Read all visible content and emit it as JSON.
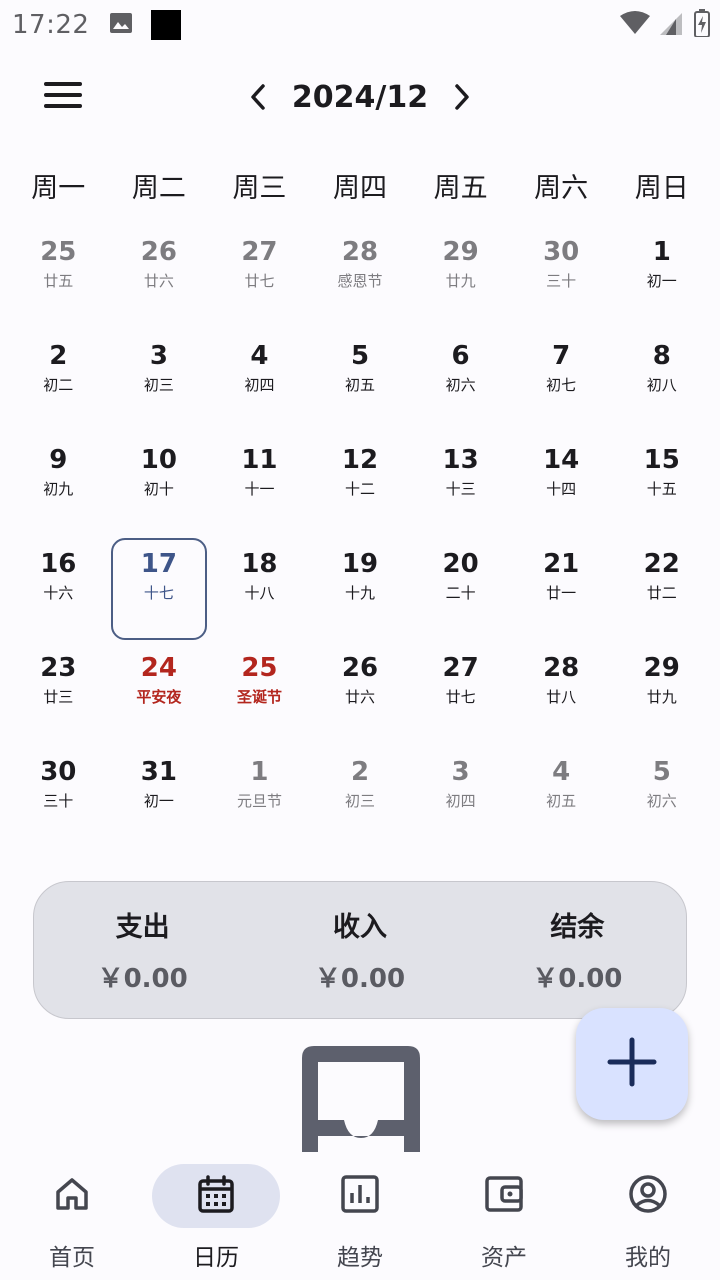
{
  "status_bar": {
    "time": "17:22",
    "icons": [
      "image-icon",
      "black-square-icon",
      "wifi-icon",
      "signal-icon",
      "battery-charging-icon"
    ]
  },
  "header": {
    "month": "2024/12",
    "menu_icon": "hamburger-menu-icon",
    "prev_icon": "chevron-left-icon",
    "next_icon": "chevron-right-icon"
  },
  "weekdays": [
    "周一",
    "周二",
    "周三",
    "周四",
    "周五",
    "周六",
    "周日"
  ],
  "calendar": {
    "weeks": [
      [
        {
          "num": "25",
          "sub": "廿五",
          "type": "other"
        },
        {
          "num": "26",
          "sub": "廿六",
          "type": "other"
        },
        {
          "num": "27",
          "sub": "廿七",
          "type": "other"
        },
        {
          "num": "28",
          "sub": "感恩节",
          "type": "other"
        },
        {
          "num": "29",
          "sub": "廿九",
          "type": "other"
        },
        {
          "num": "30",
          "sub": "三十",
          "type": "other"
        },
        {
          "num": "1",
          "sub": "初一",
          "type": "normal"
        }
      ],
      [
        {
          "num": "2",
          "sub": "初二",
          "type": "normal"
        },
        {
          "num": "3",
          "sub": "初三",
          "type": "normal"
        },
        {
          "num": "4",
          "sub": "初四",
          "type": "normal"
        },
        {
          "num": "5",
          "sub": "初五",
          "type": "normal"
        },
        {
          "num": "6",
          "sub": "初六",
          "type": "normal"
        },
        {
          "num": "7",
          "sub": "初七",
          "type": "normal"
        },
        {
          "num": "8",
          "sub": "初八",
          "type": "normal"
        }
      ],
      [
        {
          "num": "9",
          "sub": "初九",
          "type": "normal"
        },
        {
          "num": "10",
          "sub": "初十",
          "type": "normal"
        },
        {
          "num": "11",
          "sub": "十一",
          "type": "normal"
        },
        {
          "num": "12",
          "sub": "十二",
          "type": "normal"
        },
        {
          "num": "13",
          "sub": "十三",
          "type": "normal"
        },
        {
          "num": "14",
          "sub": "十四",
          "type": "normal"
        },
        {
          "num": "15",
          "sub": "十五",
          "type": "normal"
        }
      ],
      [
        {
          "num": "16",
          "sub": "十六",
          "type": "normal"
        },
        {
          "num": "17",
          "sub": "十七",
          "type": "today"
        },
        {
          "num": "18",
          "sub": "十八",
          "type": "normal"
        },
        {
          "num": "19",
          "sub": "十九",
          "type": "normal"
        },
        {
          "num": "20",
          "sub": "二十",
          "type": "normal"
        },
        {
          "num": "21",
          "sub": "廿一",
          "type": "normal"
        },
        {
          "num": "22",
          "sub": "廿二",
          "type": "normal"
        }
      ],
      [
        {
          "num": "23",
          "sub": "廿三",
          "type": "normal"
        },
        {
          "num": "24",
          "sub": "平安夜",
          "type": "holiday"
        },
        {
          "num": "25",
          "sub": "圣诞节",
          "type": "holiday"
        },
        {
          "num": "26",
          "sub": "廿六",
          "type": "normal"
        },
        {
          "num": "27",
          "sub": "廿七",
          "type": "normal"
        },
        {
          "num": "28",
          "sub": "廿八",
          "type": "normal"
        },
        {
          "num": "29",
          "sub": "廿九",
          "type": "normal"
        }
      ],
      [
        {
          "num": "30",
          "sub": "三十",
          "type": "normal"
        },
        {
          "num": "31",
          "sub": "初一",
          "type": "normal"
        },
        {
          "num": "1",
          "sub": "元旦节",
          "type": "other"
        },
        {
          "num": "2",
          "sub": "初三",
          "type": "other"
        },
        {
          "num": "3",
          "sub": "初四",
          "type": "other"
        },
        {
          "num": "4",
          "sub": "初五",
          "type": "other"
        },
        {
          "num": "5",
          "sub": "初六",
          "type": "other"
        }
      ]
    ]
  },
  "summary": {
    "expense_label": "支出",
    "expense_value": "￥0.00",
    "income_label": "收入",
    "income_value": "￥0.00",
    "balance_label": "结余",
    "balance_value": "￥0.00"
  },
  "empty_state_icon": "inbox-tray-icon",
  "fab_icon": "plus-icon",
  "bottom_nav": {
    "items": [
      {
        "label": "首页",
        "icon": "home-icon"
      },
      {
        "label": "日历",
        "icon": "calendar-icon",
        "active": true
      },
      {
        "label": "趋势",
        "icon": "bar-chart-icon"
      },
      {
        "label": "资产",
        "icon": "wallet-icon"
      },
      {
        "label": "我的",
        "icon": "account-circle-icon"
      }
    ]
  },
  "colors": {
    "holiday": "#b3261e",
    "today_border": "#4c5e85",
    "fab_bg": "#d9e2ff",
    "summary_bg": "#e1e2e8",
    "nav_active_bg": "#dfe2f0"
  }
}
